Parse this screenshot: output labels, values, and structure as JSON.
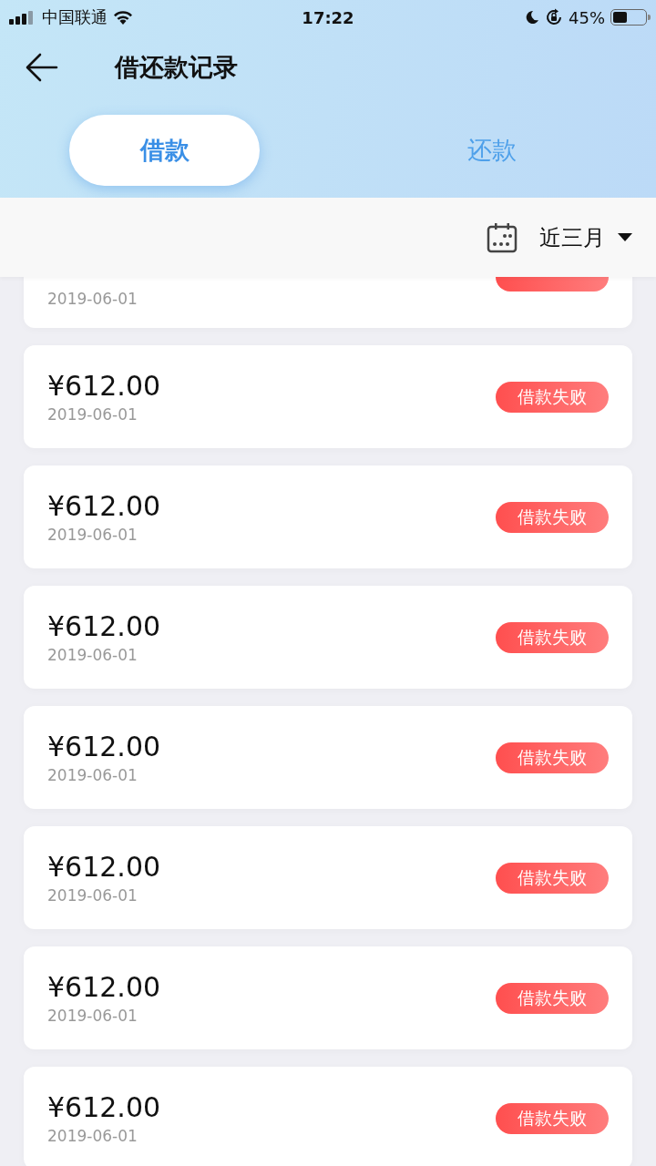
{
  "status_bar": {
    "carrier": "中国联通",
    "time": "17:22",
    "battery": "45%"
  },
  "header": {
    "title": "借还款记录"
  },
  "tabs": [
    {
      "label": "借款",
      "selected": true
    },
    {
      "label": "还款",
      "selected": false
    }
  ],
  "filter": {
    "label": "近三月"
  },
  "partial_record": {
    "date": "2019-06-01",
    "kind": "failed"
  },
  "records": [
    {
      "amount": "¥612.00",
      "date": "2019-06-01",
      "status": "借款失败",
      "kind": "failed"
    },
    {
      "amount": "¥612.00",
      "date": "2019-06-01",
      "status": "借款失败",
      "kind": "failed"
    },
    {
      "amount": "¥612.00",
      "date": "2019-06-01",
      "status": "借款失败",
      "kind": "failed"
    },
    {
      "amount": "¥612.00",
      "date": "2019-06-01",
      "status": "借款失败",
      "kind": "failed"
    },
    {
      "amount": "¥612.00",
      "date": "2019-06-01",
      "status": "借款失败",
      "kind": "failed"
    },
    {
      "amount": "¥612.00",
      "date": "2019-06-01",
      "status": "借款失败",
      "kind": "failed"
    },
    {
      "amount": "¥612.00",
      "date": "2019-06-01",
      "status": "借款失败",
      "kind": "failed"
    }
  ]
}
